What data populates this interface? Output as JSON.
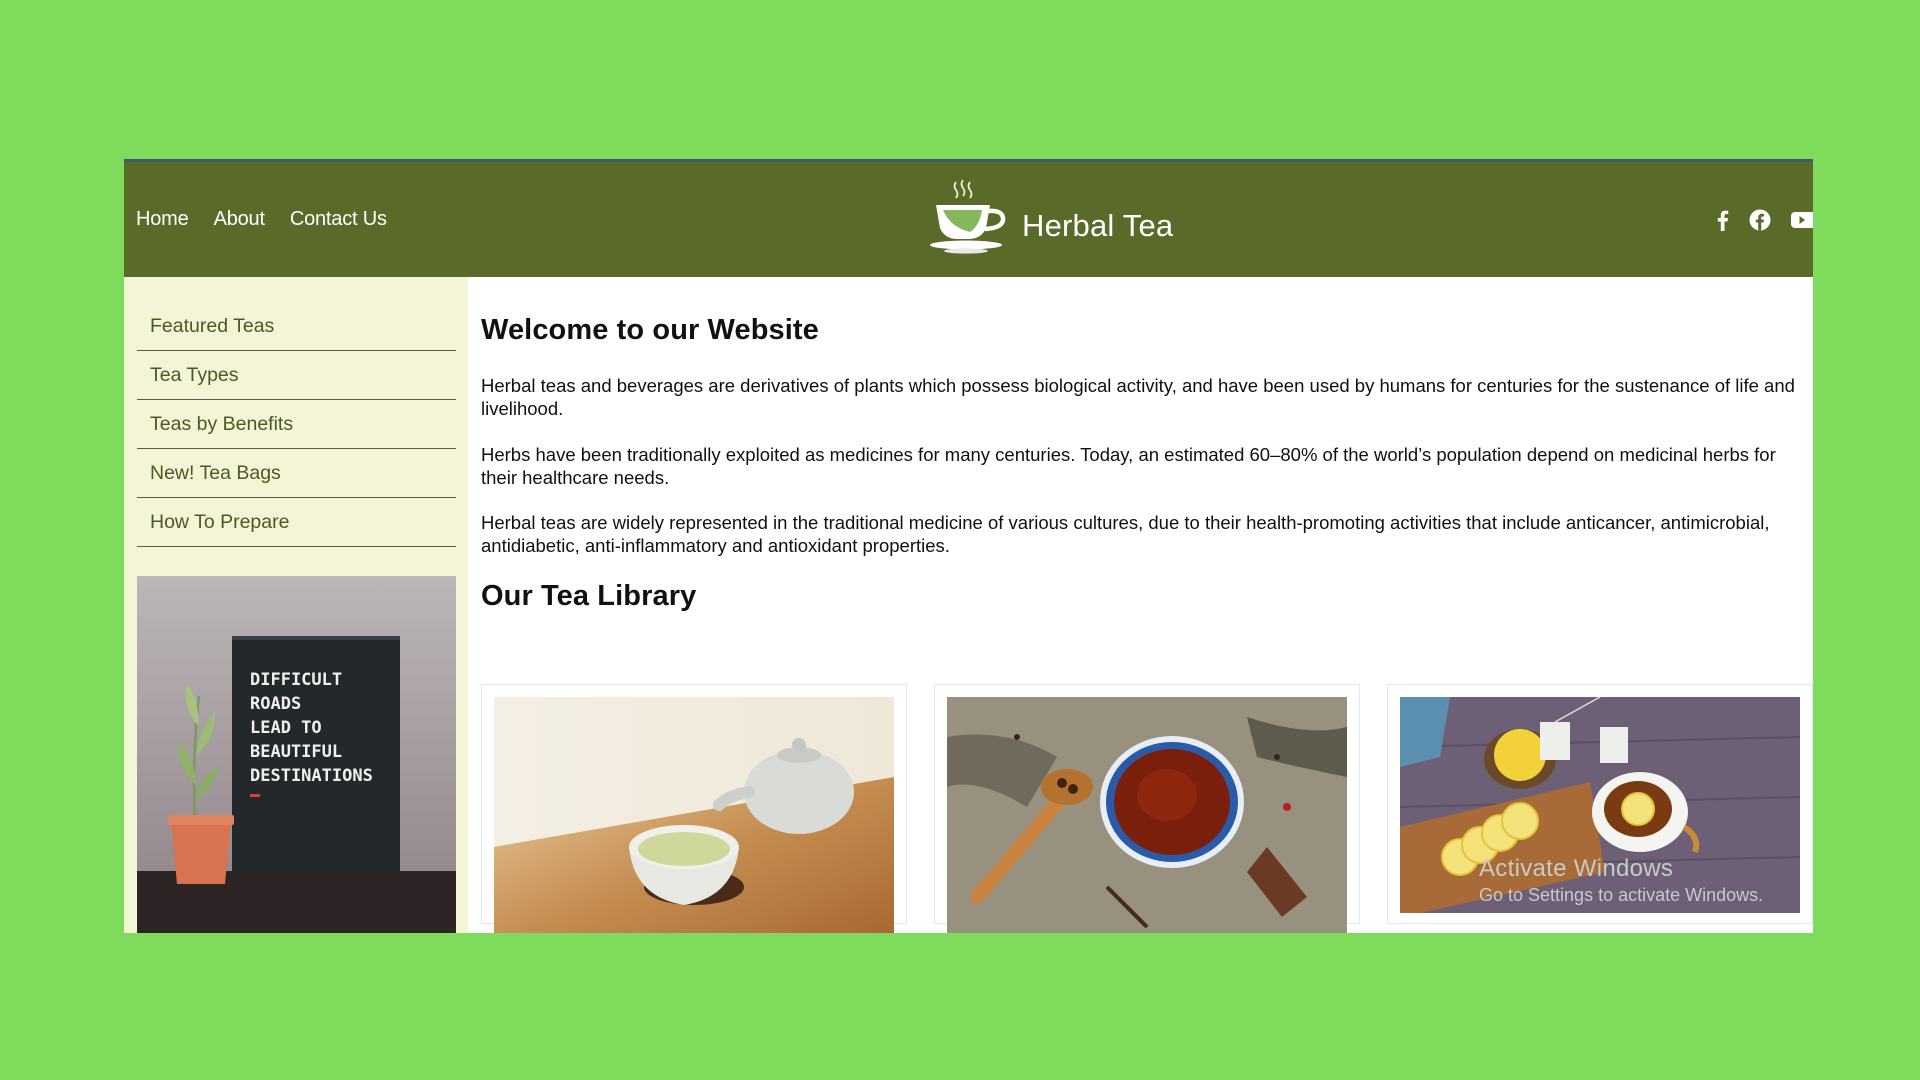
{
  "header": {
    "nav": [
      "Home",
      "About",
      "Contact Us"
    ],
    "brand_title": "Herbal Tea",
    "social_icons": [
      "facebook-f-icon",
      "facebook-circle-icon",
      "youtube-icon"
    ]
  },
  "sidebar": {
    "menu": [
      "Featured Teas",
      "Tea Types",
      "Teas by Benefits",
      "New! Tea Bags",
      "How To Prepare"
    ],
    "promo_sign": [
      "DIFFICULT",
      "ROADS",
      "LEAD TO",
      "BEAUTIFUL",
      "DESTINATIONS"
    ]
  },
  "main": {
    "heading": "Welcome to our Website",
    "paragraphs": [
      "Herbal teas and beverages are derivatives of plants which possess biological activity, and have been used by humans for centuries for the sustenance of life and livelihood.",
      "Herbs have been traditionally exploited as medicines for many centuries. Today, an estimated 60–80% of the world’s population depend on medicinal herbs for their healthcare needs.",
      "Herbal teas are widely represented in the traditional medicine of various cultures, due to their health-promoting activities that include anticancer, antimicrobial, antidiabetic, anti-inflammatory and antioxidant properties."
    ],
    "library_heading": "Our Tea Library"
  },
  "watermark": {
    "line1": "Activate Windows",
    "line2": "Go to Settings to activate Windows."
  },
  "colors": {
    "background": "#7edb5c",
    "header": "#5a6b29",
    "sidebar": "#f4f4d6",
    "menu_text": "#4b5a22"
  }
}
